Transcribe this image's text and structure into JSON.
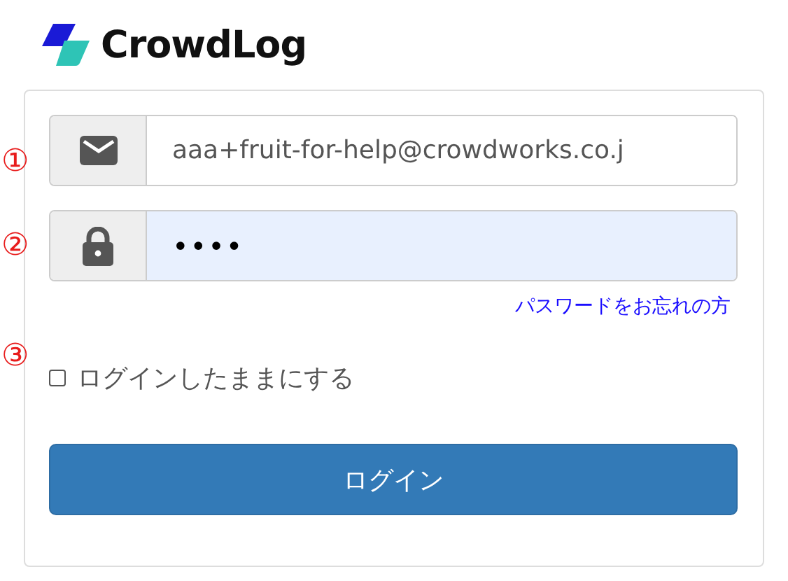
{
  "logo": {
    "text": "CrowdLog"
  },
  "fields": [
    {
      "kind": "email",
      "marker": "①",
      "value": "aaa+fruit-for-help@crowdworks.co.j",
      "autofilled": false
    },
    {
      "kind": "password",
      "marker": "②",
      "value": "••••",
      "autofilled": true
    }
  ],
  "forgot_link": "パスワードをお忘れの方",
  "remember": {
    "marker": "③",
    "label": "ログインしたままにする",
    "checked": false
  },
  "login_button": "ログイン"
}
